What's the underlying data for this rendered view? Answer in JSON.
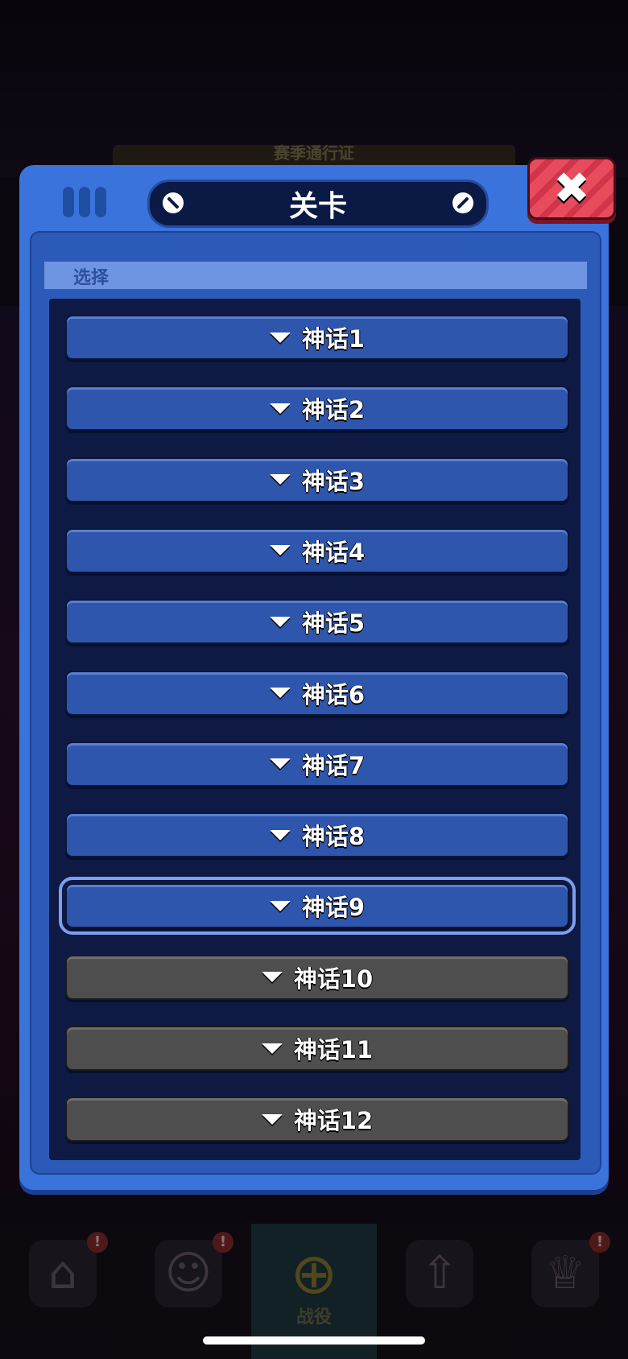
{
  "background": {
    "season_pass_label": "赛季通行证",
    "nav": [
      {
        "icon": "shop-icon",
        "glyph": "⌂",
        "label": "",
        "badge": "!",
        "active": false
      },
      {
        "icon": "brawler-icon",
        "glyph": "☺",
        "label": "",
        "badge": "!",
        "active": false
      },
      {
        "icon": "campaign-icon",
        "glyph": "⊕",
        "label": "战役",
        "badge": "",
        "active": true
      },
      {
        "icon": "upgrade-icon",
        "glyph": "⇧",
        "label": "",
        "badge": "",
        "active": false
      },
      {
        "icon": "trophy-icon",
        "glyph": "♕",
        "label": "",
        "badge": "!",
        "active": false
      }
    ]
  },
  "dialog": {
    "title": "关卡",
    "section_label": "选择",
    "close_glyph": "✖",
    "levels": [
      {
        "label": "神话1",
        "locked": false,
        "selected": false
      },
      {
        "label": "神话2",
        "locked": false,
        "selected": false
      },
      {
        "label": "神话3",
        "locked": false,
        "selected": false
      },
      {
        "label": "神话4",
        "locked": false,
        "selected": false
      },
      {
        "label": "神话5",
        "locked": false,
        "selected": false
      },
      {
        "label": "神话6",
        "locked": false,
        "selected": false
      },
      {
        "label": "神话7",
        "locked": false,
        "selected": false
      },
      {
        "label": "神话8",
        "locked": false,
        "selected": false
      },
      {
        "label": "神话9",
        "locked": false,
        "selected": true
      },
      {
        "label": "神话10",
        "locked": true,
        "selected": false
      },
      {
        "label": "神话11",
        "locked": true,
        "selected": false
      },
      {
        "label": "神话12",
        "locked": true,
        "selected": false
      }
    ]
  },
  "colors": {
    "panel": "#3b73dc",
    "list_bg": "#0f1a44",
    "unlocked_button": "#2f56ad",
    "locked_button": "#4e4e4e",
    "selected_outline": "#7e9ef0",
    "close_button": "#e84b5c"
  }
}
